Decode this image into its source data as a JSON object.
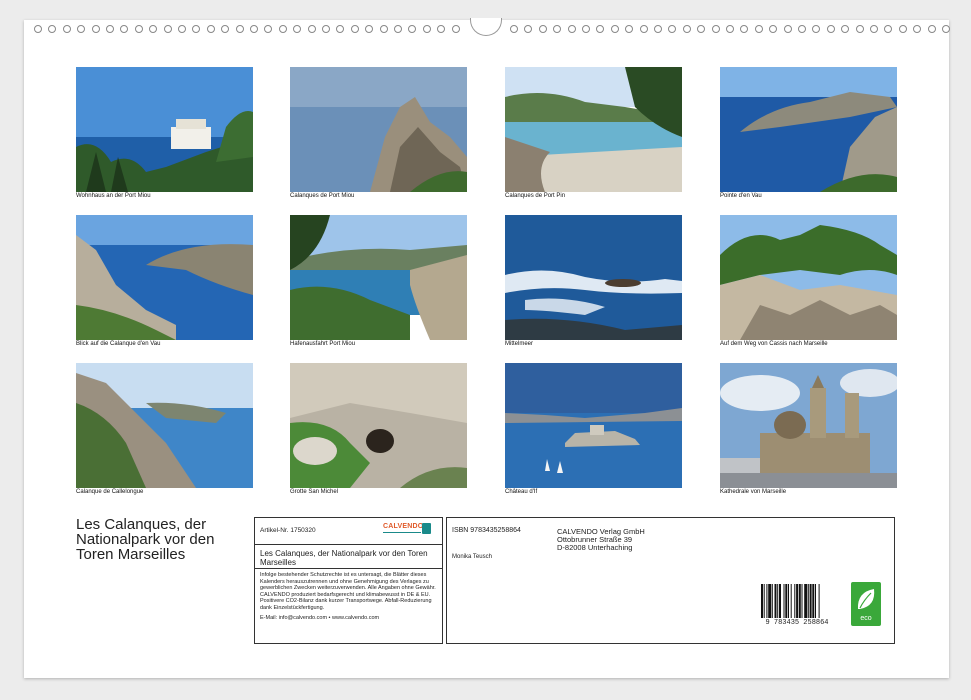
{
  "photos": [
    {
      "caption": "Wohnhaus an der Port Miou"
    },
    {
      "caption": "Calanques de Port Miou"
    },
    {
      "caption": "Calanques de Port Pin"
    },
    {
      "caption": "Pointe d'en Vau"
    },
    {
      "caption": "Blick auf die Calanque d'en Vau"
    },
    {
      "caption": "Hafenausfahrt Port Miou"
    },
    {
      "caption": "Mittelmeer"
    },
    {
      "caption": "Auf dem Weg von Cassis nach Marseille"
    },
    {
      "caption": "Calanque de Callelongue"
    },
    {
      "caption": "Grotte San Michel"
    },
    {
      "caption": "Château d'If"
    },
    {
      "caption": "Kathedrale von Marseille"
    }
  ],
  "title": "Les Calanques, der Nationalpark vor den Toren Marseilles",
  "info": {
    "article": "Artikel-Nr. 1750320",
    "brand": "CALVENDO",
    "product_title": "Les Calanques, der Nationalpark vor den Toren Marseilles",
    "legal": "Infolge bestehender Schutzrechte ist es untersagt, die Blätter dieses Kalenders herauszutrennen und ohne Genehmigung des Verlages zu gewerblichen Zwecken weiterzuverwenden. Alle Angaben ohne Gewähr. CALVENDO produziert bedarfsgerecht und klimabewusst in DE & EU. Positivere CO2-Bilanz dank kurzer Transportwege. Abfall-Reduzierung dank Einzelstückfertigung.",
    "email": "E-Mail: info@calvendo.com • www.calvendo.com",
    "isbn": "ISBN 9783435258864",
    "author": "Monika Teusch",
    "publisher": "CALVENDO Verlag GmbH",
    "street": "Ottobrunner Straße 39",
    "city": "D-82008 Unterhaching",
    "barcode": "9 783435 258864",
    "eco_label": "eco"
  }
}
